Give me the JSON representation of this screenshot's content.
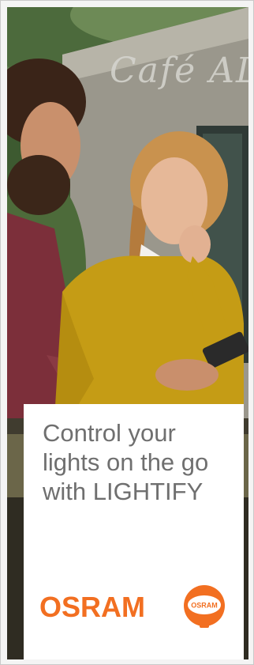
{
  "ad": {
    "headline": "Control your lights on the go with LIGHTIFY",
    "brand": "OSRAM",
    "brand_mark_text": "OSRAM",
    "background_sign": "Café ALC",
    "colors": {
      "brand_orange": "#f26f21",
      "headline_gray": "#6f6f6f",
      "card_bg": "#ffffff"
    }
  }
}
